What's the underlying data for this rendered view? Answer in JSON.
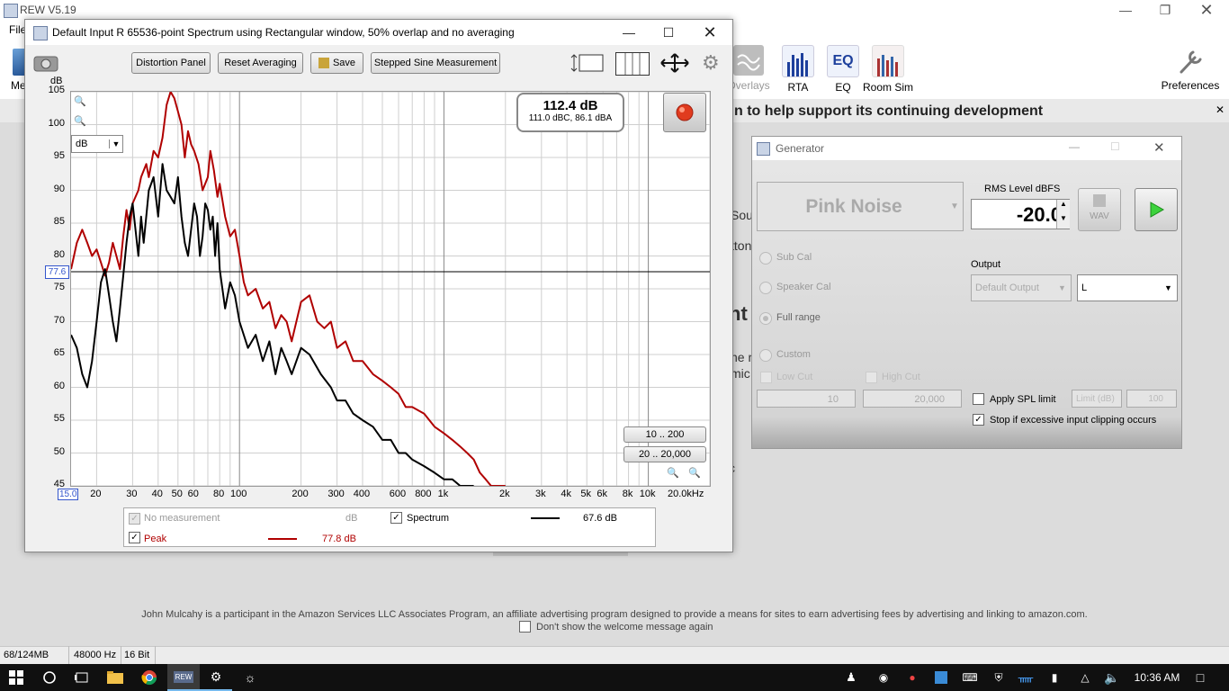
{
  "app": {
    "title": "REW V5.19",
    "menu_file": "File"
  },
  "toolbar": {
    "meas_label": "Me",
    "overlays": "Overlays",
    "rta": "RTA",
    "eq": "EQ",
    "room_sim": "Room Sim",
    "preferences": "Preferences"
  },
  "banner": {
    "text": "n to help support its continuing development"
  },
  "background": {
    "frag1": "Sou",
    "frag2": "tton",
    "frag3": "nt",
    "frag4": "he r",
    "frag5": "mic p",
    "frag6": "c"
  },
  "footer": {
    "amazon": "John Mulcahy is a participant in the Amazon Services LLC Associates Program, an affiliate advertising program designed to provide a means for sites to earn advertising fees by advertising and linking to amazon.com.",
    "dont_show": "Don't show the welcome message again"
  },
  "statusbar": {
    "memory": "68/124MB",
    "rate": "48000 Hz",
    "bits": "16 Bit"
  },
  "taskbar": {
    "time": "10:36 AM"
  },
  "spectrum": {
    "title": "Default Input R 65536-point Spectrum using Rectangular window, 50% overlap and no averaging",
    "buttons": {
      "distortion": "Distortion Panel",
      "reset": "Reset Averaging",
      "save": "Save",
      "stepped": "Stepped Sine Measurement"
    },
    "readout": {
      "main": "112.4 dB",
      "sub": "111.0 dBC, 86.1 dBA"
    },
    "unit_select": "dB",
    "range1": "10 .. 200",
    "range2": "20 .. 20,000",
    "cursor_value": "77.6",
    "legend": {
      "no_meas": "No measurement",
      "no_meas_unit": "dB",
      "spectrum": "Spectrum",
      "spectrum_val": "67.6 dB",
      "peak": "Peak",
      "peak_val": "77.8 dB"
    }
  },
  "generator": {
    "title": "Generator",
    "signal": "Pink Noise",
    "rms_label": "RMS Level dBFS",
    "rms_value": "-20.0",
    "wav": "WAV",
    "sub_cal": "Sub Cal",
    "speaker_cal": "Speaker Cal",
    "full_range": "Full range",
    "custom": "Custom",
    "low_cut": "Low Cut",
    "high_cut": "High Cut",
    "low_val": "10",
    "high_val": "20,000",
    "output_label": "Output",
    "output_device": "Default Output",
    "output_channel": "L",
    "apply_spl": "Apply SPL limit",
    "limit_placeholder": "Limit (dB)",
    "limit_val": "100",
    "stop_clip": "Stop if excessive input clipping occurs"
  },
  "chart_data": {
    "type": "line",
    "xlabel": "",
    "ylabel": "dB",
    "x_scale": "log",
    "xlim": [
      15,
      20000
    ],
    "ylim": [
      45,
      105
    ],
    "x_ticks": [
      {
        "v": 15,
        "t": "15.0"
      },
      {
        "v": 20,
        "t": "20"
      },
      {
        "v": 30,
        "t": "30"
      },
      {
        "v": 40,
        "t": "40"
      },
      {
        "v": 50,
        "t": "50"
      },
      {
        "v": 60,
        "t": "60"
      },
      {
        "v": 80,
        "t": "80"
      },
      {
        "v": 100,
        "t": "100"
      },
      {
        "v": 200,
        "t": "200"
      },
      {
        "v": 300,
        "t": "300"
      },
      {
        "v": 400,
        "t": "400"
      },
      {
        "v": 600,
        "t": "600"
      },
      {
        "v": 800,
        "t": "800"
      },
      {
        "v": 1000,
        "t": "1k"
      },
      {
        "v": 2000,
        "t": "2k"
      },
      {
        "v": 3000,
        "t": "3k"
      },
      {
        "v": 4000,
        "t": "4k"
      },
      {
        "v": 5000,
        "t": "5k"
      },
      {
        "v": 6000,
        "t": "6k"
      },
      {
        "v": 8000,
        "t": "8k"
      },
      {
        "v": 10000,
        "t": "10k"
      },
      {
        "v": 20000,
        "t": "20.0kHz"
      }
    ],
    "y_ticks": [
      105,
      100,
      95,
      90,
      85,
      80,
      75,
      70,
      65,
      60,
      55,
      50,
      45
    ],
    "cursor_db": 77.6,
    "series": [
      {
        "name": "Peak",
        "color": "#b00000",
        "points": [
          [
            15,
            78
          ],
          [
            16,
            82
          ],
          [
            17,
            84
          ],
          [
            18,
            82
          ],
          [
            19,
            80
          ],
          [
            20,
            81
          ],
          [
            21,
            79
          ],
          [
            22,
            77
          ],
          [
            23,
            79
          ],
          [
            24,
            82
          ],
          [
            25,
            80
          ],
          [
            26,
            78
          ],
          [
            27,
            83
          ],
          [
            28,
            87
          ],
          [
            29,
            84
          ],
          [
            30,
            88
          ],
          [
            32,
            90
          ],
          [
            33,
            92
          ],
          [
            35,
            94
          ],
          [
            36,
            92
          ],
          [
            38,
            96
          ],
          [
            40,
            95
          ],
          [
            42,
            98
          ],
          [
            44,
            103
          ],
          [
            46,
            105
          ],
          [
            48,
            104
          ],
          [
            50,
            102
          ],
          [
            52,
            100
          ],
          [
            54,
            95
          ],
          [
            56,
            99
          ],
          [
            58,
            97
          ],
          [
            60,
            96
          ],
          [
            63,
            94
          ],
          [
            66,
            90
          ],
          [
            70,
            92
          ],
          [
            72,
            96
          ],
          [
            75,
            93
          ],
          [
            78,
            89
          ],
          [
            80,
            91
          ],
          [
            85,
            86
          ],
          [
            90,
            83
          ],
          [
            95,
            84
          ],
          [
            100,
            80
          ],
          [
            105,
            76
          ],
          [
            110,
            74
          ],
          [
            120,
            75
          ],
          [
            130,
            72
          ],
          [
            140,
            73
          ],
          [
            150,
            69
          ],
          [
            160,
            71
          ],
          [
            170,
            70
          ],
          [
            180,
            67
          ],
          [
            200,
            73
          ],
          [
            220,
            74
          ],
          [
            240,
            70
          ],
          [
            260,
            69
          ],
          [
            280,
            70
          ],
          [
            300,
            66
          ],
          [
            330,
            67
          ],
          [
            360,
            64
          ],
          [
            400,
            64
          ],
          [
            450,
            62
          ],
          [
            500,
            61
          ],
          [
            550,
            60
          ],
          [
            600,
            59
          ],
          [
            650,
            57
          ],
          [
            700,
            57
          ],
          [
            800,
            56
          ],
          [
            900,
            54
          ],
          [
            1000,
            53
          ],
          [
            1100,
            52
          ],
          [
            1200,
            51
          ],
          [
            1300,
            50
          ],
          [
            1400,
            49
          ],
          [
            1500,
            47
          ],
          [
            1600,
            46
          ],
          [
            1700,
            45
          ],
          [
            2000,
            45
          ]
        ]
      },
      {
        "name": "Spectrum",
        "color": "#000000",
        "points": [
          [
            15,
            68
          ],
          [
            16,
            66
          ],
          [
            17,
            62
          ],
          [
            18,
            60
          ],
          [
            19,
            64
          ],
          [
            20,
            70
          ],
          [
            21,
            76
          ],
          [
            22,
            78
          ],
          [
            23,
            74
          ],
          [
            24,
            70
          ],
          [
            25,
            67
          ],
          [
            26,
            72
          ],
          [
            27,
            77
          ],
          [
            28,
            82
          ],
          [
            29,
            86
          ],
          [
            30,
            88
          ],
          [
            31,
            84
          ],
          [
            32,
            80
          ],
          [
            33,
            86
          ],
          [
            34,
            82
          ],
          [
            36,
            90
          ],
          [
            38,
            92
          ],
          [
            40,
            86
          ],
          [
            42,
            94
          ],
          [
            44,
            90
          ],
          [
            46,
            89
          ],
          [
            48,
            88
          ],
          [
            50,
            92
          ],
          [
            52,
            86
          ],
          [
            54,
            82
          ],
          [
            56,
            80
          ],
          [
            58,
            84
          ],
          [
            60,
            88
          ],
          [
            62,
            86
          ],
          [
            64,
            80
          ],
          [
            66,
            83
          ],
          [
            68,
            88
          ],
          [
            70,
            87
          ],
          [
            72,
            84
          ],
          [
            74,
            86
          ],
          [
            76,
            80
          ],
          [
            78,
            85
          ],
          [
            80,
            78
          ],
          [
            85,
            72
          ],
          [
            90,
            76
          ],
          [
            95,
            74
          ],
          [
            100,
            70
          ],
          [
            110,
            66
          ],
          [
            120,
            68
          ],
          [
            130,
            64
          ],
          [
            140,
            67
          ],
          [
            150,
            62
          ],
          [
            160,
            66
          ],
          [
            170,
            64
          ],
          [
            180,
            62
          ],
          [
            200,
            66
          ],
          [
            220,
            65
          ],
          [
            250,
            62
          ],
          [
            280,
            60
          ],
          [
            300,
            58
          ],
          [
            330,
            58
          ],
          [
            360,
            56
          ],
          [
            400,
            55
          ],
          [
            450,
            54
          ],
          [
            500,
            52
          ],
          [
            550,
            52
          ],
          [
            600,
            50
          ],
          [
            650,
            50
          ],
          [
            700,
            49
          ],
          [
            800,
            48
          ],
          [
            900,
            47
          ],
          [
            1000,
            46
          ],
          [
            1100,
            46
          ],
          [
            1200,
            45
          ],
          [
            1400,
            45
          ]
        ]
      }
    ]
  }
}
